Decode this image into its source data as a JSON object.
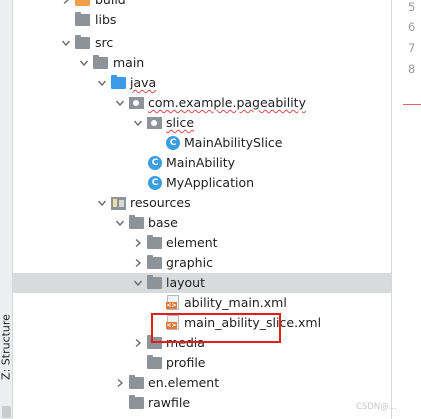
{
  "tool_window": {
    "side_label": "Z: Structure"
  },
  "tree": [
    {
      "label": "build",
      "icon": "orange-folder-icon"
    },
    {
      "label": "libs",
      "icon": "folder-icon"
    },
    {
      "label": "src",
      "icon": "folder-icon"
    },
    {
      "label": "main",
      "icon": "folder-icon"
    },
    {
      "label": "java",
      "icon": "source-folder-icon"
    },
    {
      "label": "com.example.pageability",
      "icon": "package-icon"
    },
    {
      "label": "slice",
      "icon": "package-icon"
    },
    {
      "label": "MainAbilitySlice",
      "icon": "class-icon",
      "icon_glyph": "C"
    },
    {
      "label": "MainAbility",
      "icon": "class-icon",
      "icon_glyph": "C"
    },
    {
      "label": "MyApplication",
      "icon": "class-icon",
      "icon_glyph": "C"
    },
    {
      "label": "resources",
      "icon": "resources-folder-icon"
    },
    {
      "label": "base",
      "icon": "folder-icon"
    },
    {
      "label": "element",
      "icon": "folder-icon"
    },
    {
      "label": "graphic",
      "icon": "folder-icon"
    },
    {
      "label": "layout",
      "icon": "folder-icon",
      "selected": true
    },
    {
      "label": "ability_main.xml",
      "icon": "xml-file-icon",
      "icon_glyph": "<>"
    },
    {
      "label": "main_ability_slice.xml",
      "icon": "xml-file-icon",
      "icon_glyph": "<>",
      "highlighted": true
    },
    {
      "label": "media",
      "icon": "folder-icon"
    },
    {
      "label": "profile",
      "icon": "folder-icon"
    },
    {
      "label": "en.element",
      "icon": "folder-icon"
    },
    {
      "label": "rawfile",
      "icon": "folder-icon"
    }
  ],
  "gutter": {
    "line_numbers": [
      "5",
      "6",
      "7",
      "8"
    ]
  },
  "watermark": "CSDN@..."
}
